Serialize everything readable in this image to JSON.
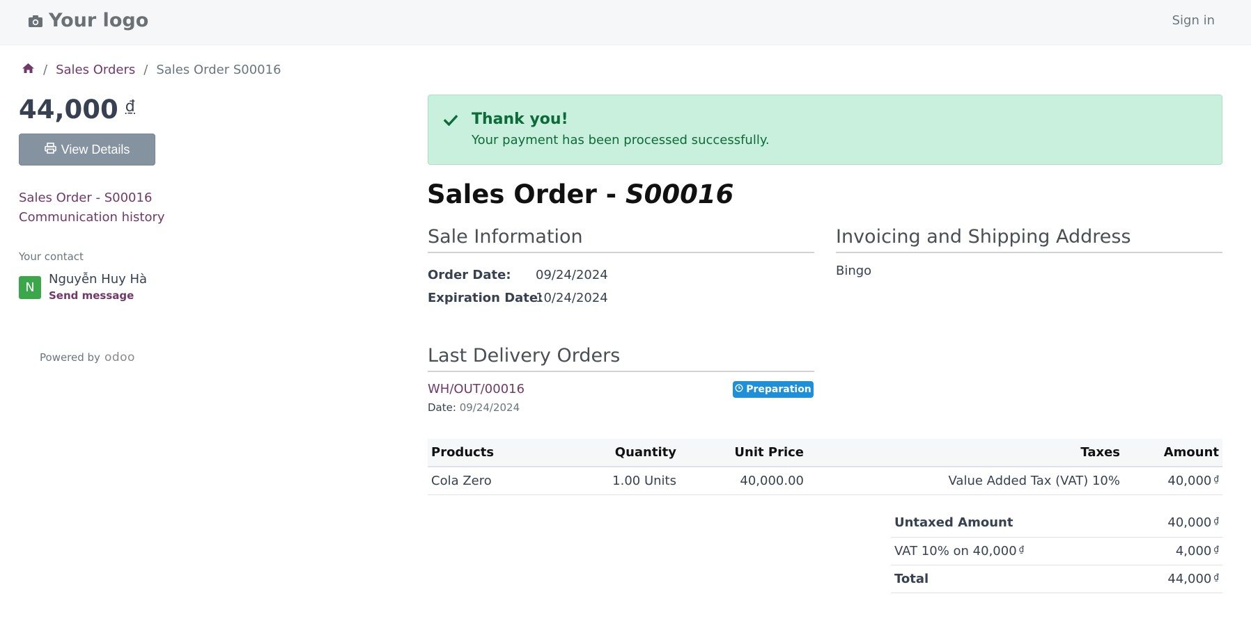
{
  "header": {
    "logo_text": "Your logo",
    "sign_in": "Sign in"
  },
  "breadcrumb": {
    "home_icon": "home-icon",
    "items": [
      "Sales Orders",
      "Sales Order S00016"
    ]
  },
  "sidebar": {
    "amount": "44,000",
    "currency": "₫",
    "view_details_label": "View Details",
    "links": [
      "Sales Order - S00016",
      "Communication history"
    ],
    "contact_label": "Your contact",
    "contact_initial": "N",
    "contact_name": "Nguyễn Huy Hà",
    "send_message": "Send message",
    "powered_by": "Powered by",
    "powered_brand": "odoo"
  },
  "alert": {
    "title": "Thank you!",
    "message": "Your payment has been processed successfully."
  },
  "order": {
    "title_prefix": "Sales Order - ",
    "number": "S00016",
    "sale_info_heading": "Sale Information",
    "order_date_label": "Order Date:",
    "order_date": "09/24/2024",
    "expiration_date_label": "Expiration Date:",
    "expiration_date": "10/24/2024",
    "address_heading": "Invoicing and Shipping Address",
    "address": "Bingo"
  },
  "delivery": {
    "heading": "Last Delivery Orders",
    "reference": "WH/OUT/00016",
    "status": "Preparation",
    "date_label": "Date:",
    "date": "09/24/2024"
  },
  "lines": {
    "headers": [
      "Products",
      "Quantity",
      "Unit Price",
      "Taxes",
      "Amount"
    ],
    "rows": [
      {
        "product": "Cola Zero",
        "quantity": "1.00 Units",
        "unit_price": "40,000.00",
        "taxes": "Value Added Tax (VAT) 10%",
        "amount": "40,000",
        "currency": "₫"
      }
    ]
  },
  "totals": {
    "untaxed_label": "Untaxed Amount",
    "untaxed_value": "40,000",
    "vat_label": "VAT 10% on 40,000",
    "vat_label_currency": "₫",
    "vat_value": "4,000",
    "total_label": "Total",
    "total_value": "44,000",
    "currency": "₫"
  },
  "colors": {
    "link": "#71396a",
    "alert_bg": "#c9efdd",
    "alert_text": "#0c6b3a",
    "badge": "#1d90d9",
    "avatar": "#3aa84a"
  }
}
